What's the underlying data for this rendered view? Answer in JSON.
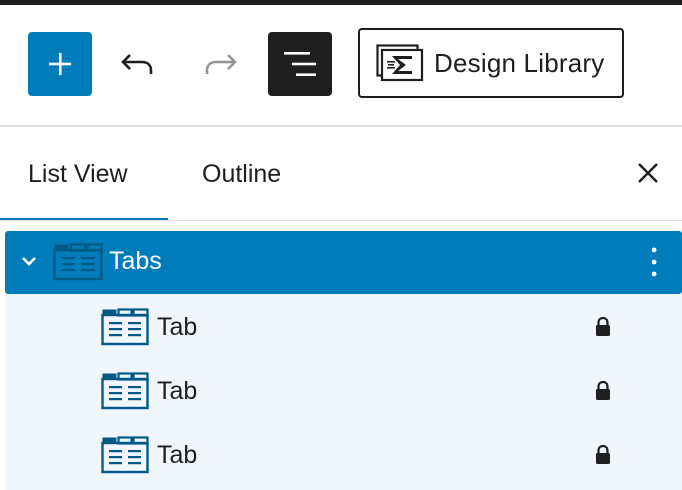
{
  "toolbar": {
    "add_icon": "plus-icon",
    "undo_icon": "undo-icon",
    "redo_icon": "redo-icon",
    "list_view_icon": "list-view-icon",
    "design_library_label": "Design Library",
    "design_library_icon": "kadence-logo-icon",
    "accent_color": "#007cba"
  },
  "panel": {
    "tabs": [
      {
        "label": "List View",
        "active": true
      },
      {
        "label": "Outline",
        "active": false
      }
    ],
    "close_icon": "close-icon"
  },
  "tree": {
    "parent": {
      "label": "Tabs",
      "expanded": true,
      "selected": true
    },
    "children": [
      {
        "label": "Tab",
        "locked": true
      },
      {
        "label": "Tab",
        "locked": true
      },
      {
        "label": "Tab",
        "locked": true
      }
    ]
  }
}
